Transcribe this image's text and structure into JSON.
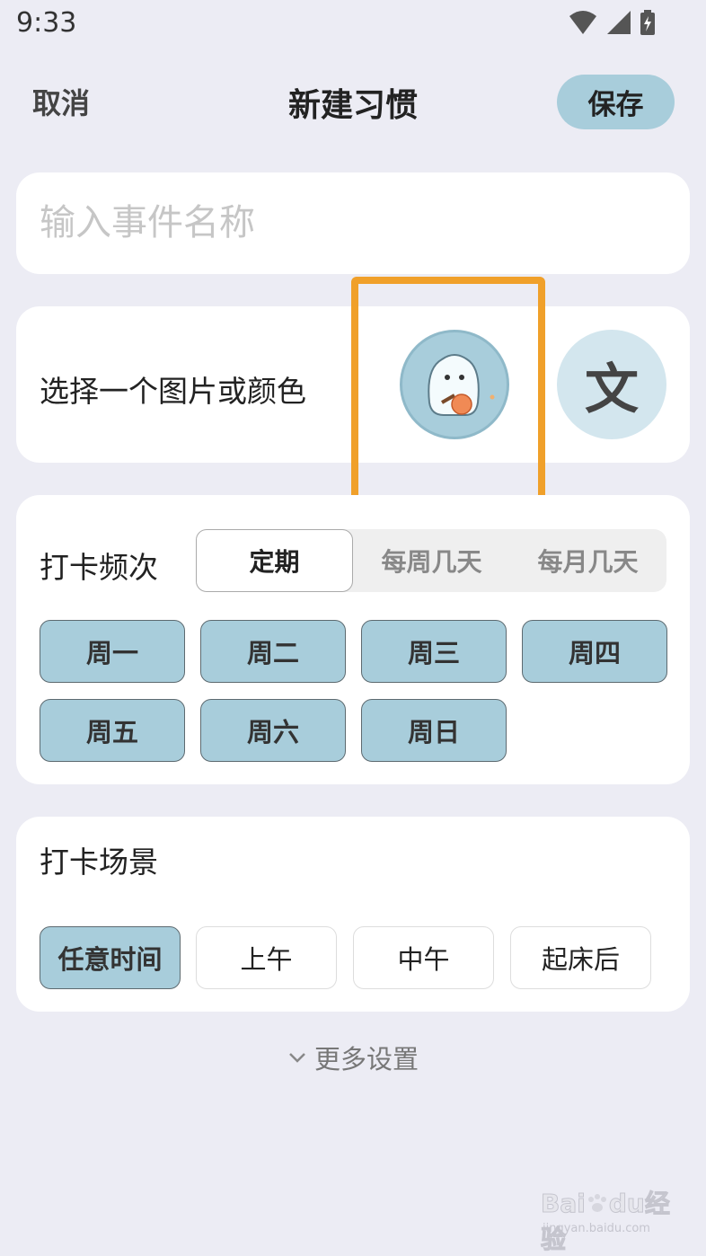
{
  "status_bar": {
    "time": "9:33",
    "icons": [
      "wifi-icon",
      "signal-icon",
      "battery-icon"
    ]
  },
  "header": {
    "cancel_label": "取消",
    "title": "新建习惯",
    "save_label": "保存"
  },
  "name_field": {
    "placeholder": "输入事件名称",
    "value": ""
  },
  "picture": {
    "label": "选择一个图片或颜色",
    "avatar_icon": "ghost-pingpong-avatar-icon",
    "text_option": "文"
  },
  "frequency": {
    "label": "打卡频次",
    "tabs": [
      {
        "label": "定期",
        "active": true
      },
      {
        "label": "每周几天",
        "active": false
      },
      {
        "label": "每月几天",
        "active": false
      }
    ],
    "days": [
      "周一",
      "周二",
      "周三",
      "周四",
      "周五",
      "周六",
      "周日"
    ]
  },
  "scene": {
    "label": "打卡场景",
    "options": [
      {
        "label": "任意时间",
        "active": true
      },
      {
        "label": "上午",
        "active": false
      },
      {
        "label": "中午",
        "active": false
      },
      {
        "label": "起床后",
        "active": false
      }
    ]
  },
  "more_settings": {
    "label": "更多设置"
  },
  "watermark": {
    "brand": "Bai",
    "brand_suffix": "du",
    "brand_cn": "经验",
    "url": "jingyan.baidu.com"
  },
  "colors": {
    "accent": "#a8cddb",
    "highlight": "#f0a02a",
    "background": "#ececf4"
  }
}
